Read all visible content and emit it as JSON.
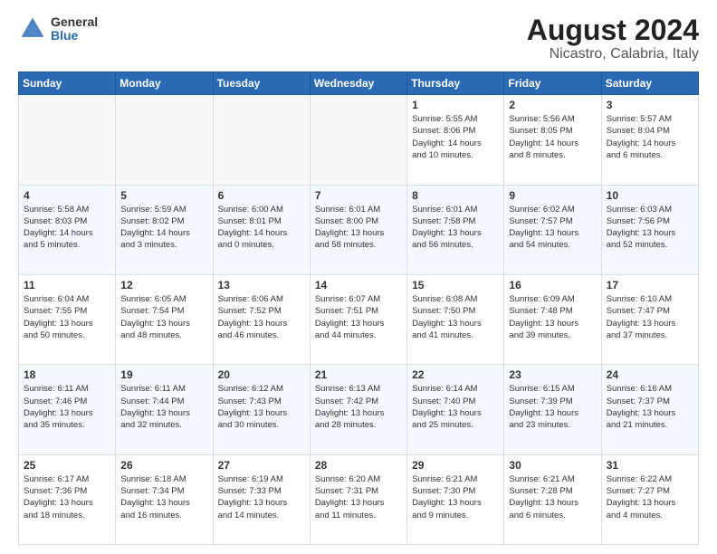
{
  "logo": {
    "general": "General",
    "blue": "Blue"
  },
  "header": {
    "title": "August 2024",
    "subtitle": "Nicastro, Calabria, Italy"
  },
  "weekdays": [
    "Sunday",
    "Monday",
    "Tuesday",
    "Wednesday",
    "Thursday",
    "Friday",
    "Saturday"
  ],
  "weeks": [
    [
      {
        "day": "",
        "info": ""
      },
      {
        "day": "",
        "info": ""
      },
      {
        "day": "",
        "info": ""
      },
      {
        "day": "",
        "info": ""
      },
      {
        "day": "1",
        "info": "Sunrise: 5:55 AM\nSunset: 8:06 PM\nDaylight: 14 hours\nand 10 minutes."
      },
      {
        "day": "2",
        "info": "Sunrise: 5:56 AM\nSunset: 8:05 PM\nDaylight: 14 hours\nand 8 minutes."
      },
      {
        "day": "3",
        "info": "Sunrise: 5:57 AM\nSunset: 8:04 PM\nDaylight: 14 hours\nand 6 minutes."
      }
    ],
    [
      {
        "day": "4",
        "info": "Sunrise: 5:58 AM\nSunset: 8:03 PM\nDaylight: 14 hours\nand 5 minutes."
      },
      {
        "day": "5",
        "info": "Sunrise: 5:59 AM\nSunset: 8:02 PM\nDaylight: 14 hours\nand 3 minutes."
      },
      {
        "day": "6",
        "info": "Sunrise: 6:00 AM\nSunset: 8:01 PM\nDaylight: 14 hours\nand 0 minutes."
      },
      {
        "day": "7",
        "info": "Sunrise: 6:01 AM\nSunset: 8:00 PM\nDaylight: 13 hours\nand 58 minutes."
      },
      {
        "day": "8",
        "info": "Sunrise: 6:01 AM\nSunset: 7:58 PM\nDaylight: 13 hours\nand 56 minutes."
      },
      {
        "day": "9",
        "info": "Sunrise: 6:02 AM\nSunset: 7:57 PM\nDaylight: 13 hours\nand 54 minutes."
      },
      {
        "day": "10",
        "info": "Sunrise: 6:03 AM\nSunset: 7:56 PM\nDaylight: 13 hours\nand 52 minutes."
      }
    ],
    [
      {
        "day": "11",
        "info": "Sunrise: 6:04 AM\nSunset: 7:55 PM\nDaylight: 13 hours\nand 50 minutes."
      },
      {
        "day": "12",
        "info": "Sunrise: 6:05 AM\nSunset: 7:54 PM\nDaylight: 13 hours\nand 48 minutes."
      },
      {
        "day": "13",
        "info": "Sunrise: 6:06 AM\nSunset: 7:52 PM\nDaylight: 13 hours\nand 46 minutes."
      },
      {
        "day": "14",
        "info": "Sunrise: 6:07 AM\nSunset: 7:51 PM\nDaylight: 13 hours\nand 44 minutes."
      },
      {
        "day": "15",
        "info": "Sunrise: 6:08 AM\nSunset: 7:50 PM\nDaylight: 13 hours\nand 41 minutes."
      },
      {
        "day": "16",
        "info": "Sunrise: 6:09 AM\nSunset: 7:48 PM\nDaylight: 13 hours\nand 39 minutes."
      },
      {
        "day": "17",
        "info": "Sunrise: 6:10 AM\nSunset: 7:47 PM\nDaylight: 13 hours\nand 37 minutes."
      }
    ],
    [
      {
        "day": "18",
        "info": "Sunrise: 6:11 AM\nSunset: 7:46 PM\nDaylight: 13 hours\nand 35 minutes."
      },
      {
        "day": "19",
        "info": "Sunrise: 6:11 AM\nSunset: 7:44 PM\nDaylight: 13 hours\nand 32 minutes."
      },
      {
        "day": "20",
        "info": "Sunrise: 6:12 AM\nSunset: 7:43 PM\nDaylight: 13 hours\nand 30 minutes."
      },
      {
        "day": "21",
        "info": "Sunrise: 6:13 AM\nSunset: 7:42 PM\nDaylight: 13 hours\nand 28 minutes."
      },
      {
        "day": "22",
        "info": "Sunrise: 6:14 AM\nSunset: 7:40 PM\nDaylight: 13 hours\nand 25 minutes."
      },
      {
        "day": "23",
        "info": "Sunrise: 6:15 AM\nSunset: 7:39 PM\nDaylight: 13 hours\nand 23 minutes."
      },
      {
        "day": "24",
        "info": "Sunrise: 6:16 AM\nSunset: 7:37 PM\nDaylight: 13 hours\nand 21 minutes."
      }
    ],
    [
      {
        "day": "25",
        "info": "Sunrise: 6:17 AM\nSunset: 7:36 PM\nDaylight: 13 hours\nand 18 minutes."
      },
      {
        "day": "26",
        "info": "Sunrise: 6:18 AM\nSunset: 7:34 PM\nDaylight: 13 hours\nand 16 minutes."
      },
      {
        "day": "27",
        "info": "Sunrise: 6:19 AM\nSunset: 7:33 PM\nDaylight: 13 hours\nand 14 minutes."
      },
      {
        "day": "28",
        "info": "Sunrise: 6:20 AM\nSunset: 7:31 PM\nDaylight: 13 hours\nand 11 minutes."
      },
      {
        "day": "29",
        "info": "Sunrise: 6:21 AM\nSunset: 7:30 PM\nDaylight: 13 hours\nand 9 minutes."
      },
      {
        "day": "30",
        "info": "Sunrise: 6:21 AM\nSunset: 7:28 PM\nDaylight: 13 hours\nand 6 minutes."
      },
      {
        "day": "31",
        "info": "Sunrise: 6:22 AM\nSunset: 7:27 PM\nDaylight: 13 hours\nand 4 minutes."
      }
    ]
  ]
}
